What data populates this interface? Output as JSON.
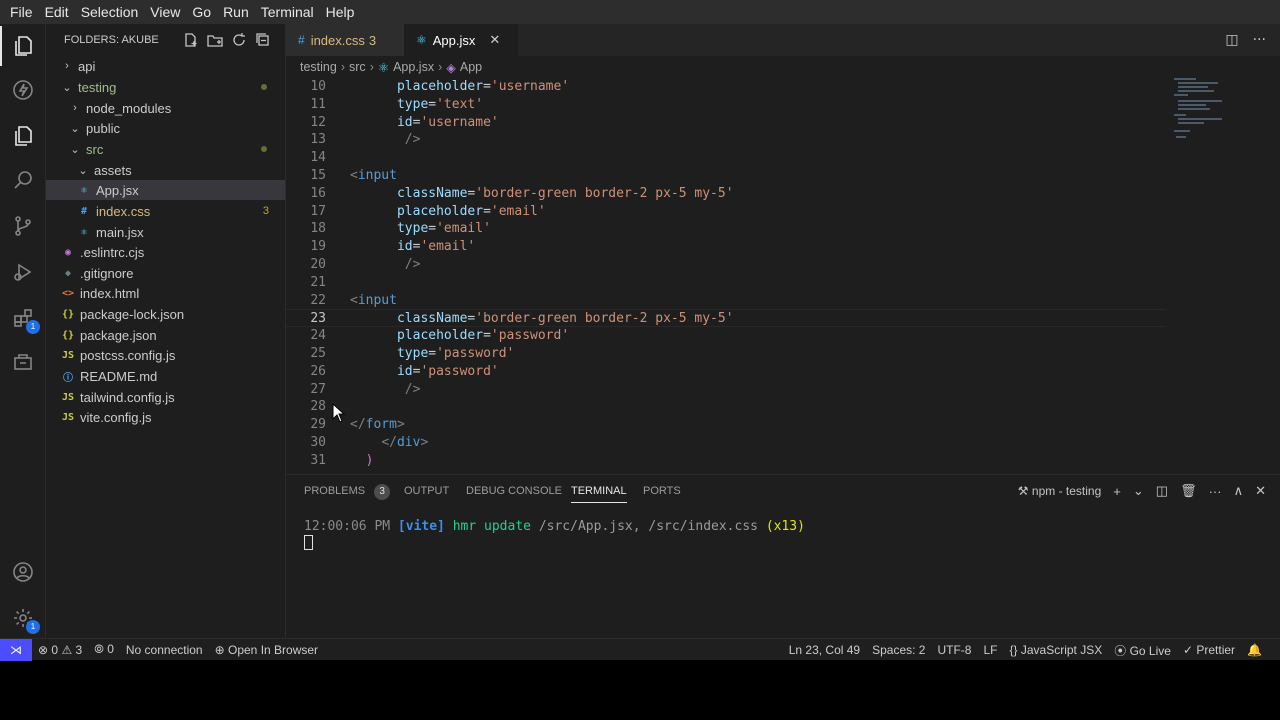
{
  "menu": [
    "File",
    "Edit",
    "Selection",
    "View",
    "Go",
    "Run",
    "Terminal",
    "Help"
  ],
  "activity": {
    "extensions_badge": "1",
    "settings_badge": "1"
  },
  "explorer": {
    "title": "FOLDERS: AKUBE",
    "items": [
      {
        "label": "api",
        "chevron": "›",
        "icon": "",
        "icon_color": "#cccccc"
      },
      {
        "label": "testing",
        "chevron": "⌄",
        "icon": "",
        "icon_color": "#cccccc"
      },
      {
        "label": "node_modules",
        "chevron": "›",
        "icon": "",
        "icon_color": "#cccccc"
      },
      {
        "label": "public",
        "chevron": "⌄",
        "icon": "",
        "icon_color": "#cccccc"
      },
      {
        "label": "src",
        "chevron": "⌄",
        "icon": "",
        "icon_color": "#cccccc"
      },
      {
        "label": "assets",
        "chevron": "⌄",
        "icon": "",
        "icon_color": "#cccccc"
      },
      {
        "label": "App.jsx",
        "chevron": "",
        "icon": "⚛",
        "icon_color": "#61dafb"
      },
      {
        "label": "index.css",
        "chevron": "",
        "icon": "#",
        "icon_color": "#42a5f5",
        "count": "3"
      },
      {
        "label": "main.jsx",
        "chevron": "",
        "icon": "⚛",
        "icon_color": "#61dafb"
      },
      {
        "label": ".eslintrc.cjs",
        "chevron": "",
        "icon": "◉",
        "icon_color": "#c678dd"
      },
      {
        "label": ".gitignore",
        "chevron": "",
        "icon": "◆",
        "icon_color": "#6d8086"
      },
      {
        "label": "index.html",
        "chevron": "",
        "icon": "<>",
        "icon_color": "#e37933"
      },
      {
        "label": "package-lock.json",
        "chevron": "",
        "icon": "{}",
        "icon_color": "#cbcb41"
      },
      {
        "label": "package.json",
        "chevron": "",
        "icon": "{}",
        "icon_color": "#cbcb41"
      },
      {
        "label": "postcss.config.js",
        "chevron": "",
        "icon": "JS",
        "icon_color": "#cbcb41"
      },
      {
        "label": "README.md",
        "chevron": "",
        "icon": "ⓘ",
        "icon_color": "#42a5f5"
      },
      {
        "label": "tailwind.config.js",
        "chevron": "",
        "icon": "JS",
        "icon_color": "#cbcb41"
      },
      {
        "label": "vite.config.js",
        "chevron": "",
        "icon": "JS",
        "icon_color": "#cbcb41"
      }
    ]
  },
  "tabs": [
    {
      "label": "index.css",
      "badge": "3",
      "icon": "#"
    },
    {
      "label": "App.jsx",
      "icon": "⚛",
      "close": "✕"
    }
  ],
  "breadcrumb": [
    "testing",
    "src",
    "App.jsx",
    "App"
  ],
  "code_lines": [
    {
      "n": "10",
      "tokens": [
        {
          "t": "      ",
          "c": ""
        },
        {
          "t": "placeholder",
          "c": "attr"
        },
        {
          "t": "=",
          "c": ""
        },
        {
          "t": "'username'",
          "c": "str"
        }
      ]
    },
    {
      "n": "11",
      "tokens": [
        {
          "t": "      ",
          "c": ""
        },
        {
          "t": "type",
          "c": "attr"
        },
        {
          "t": "=",
          "c": ""
        },
        {
          "t": "'text'",
          "c": "str"
        }
      ]
    },
    {
      "n": "12",
      "tokens": [
        {
          "t": "      ",
          "c": ""
        },
        {
          "t": "id",
          "c": "attr"
        },
        {
          "t": "=",
          "c": ""
        },
        {
          "t": "'username'",
          "c": "str"
        }
      ]
    },
    {
      "n": "13",
      "tokens": [
        {
          "t": "       ",
          "c": ""
        },
        {
          "t": "/>",
          "c": "punct"
        }
      ]
    },
    {
      "n": "14",
      "tokens": []
    },
    {
      "n": "15",
      "tokens": [
        {
          "t": "<",
          "c": "punct"
        },
        {
          "t": "input",
          "c": "tag"
        }
      ]
    },
    {
      "n": "16",
      "tokens": [
        {
          "t": "      ",
          "c": ""
        },
        {
          "t": "className",
          "c": "attr"
        },
        {
          "t": "=",
          "c": ""
        },
        {
          "t": "'border-green border-2 px-5 my-5'",
          "c": "str"
        }
      ]
    },
    {
      "n": "17",
      "tokens": [
        {
          "t": "      ",
          "c": ""
        },
        {
          "t": "placeholder",
          "c": "attr"
        },
        {
          "t": "=",
          "c": ""
        },
        {
          "t": "'email'",
          "c": "str"
        }
      ]
    },
    {
      "n": "18",
      "tokens": [
        {
          "t": "      ",
          "c": ""
        },
        {
          "t": "type",
          "c": "attr"
        },
        {
          "t": "=",
          "c": ""
        },
        {
          "t": "'email'",
          "c": "str"
        }
      ]
    },
    {
      "n": "19",
      "tokens": [
        {
          "t": "      ",
          "c": ""
        },
        {
          "t": "id",
          "c": "attr"
        },
        {
          "t": "=",
          "c": ""
        },
        {
          "t": "'email'",
          "c": "str"
        }
      ]
    },
    {
      "n": "20",
      "tokens": [
        {
          "t": "       ",
          "c": ""
        },
        {
          "t": "/>",
          "c": "punct"
        }
      ]
    },
    {
      "n": "21",
      "tokens": []
    },
    {
      "n": "22",
      "tokens": [
        {
          "t": "<",
          "c": "punct"
        },
        {
          "t": "input",
          "c": "tag"
        }
      ]
    },
    {
      "n": "23",
      "tokens": [
        {
          "t": "      ",
          "c": ""
        },
        {
          "t": "className",
          "c": "attr"
        },
        {
          "t": "=",
          "c": ""
        },
        {
          "t": "'border-green border-2 px-5 my-5'",
          "c": "str"
        }
      ],
      "current": true
    },
    {
      "n": "24",
      "tokens": [
        {
          "t": "      ",
          "c": ""
        },
        {
          "t": "placeholder",
          "c": "attr"
        },
        {
          "t": "=",
          "c": ""
        },
        {
          "t": "'password'",
          "c": "str"
        }
      ]
    },
    {
      "n": "25",
      "tokens": [
        {
          "t": "      ",
          "c": ""
        },
        {
          "t": "type",
          "c": "attr"
        },
        {
          "t": "=",
          "c": ""
        },
        {
          "t": "'password'",
          "c": "str"
        }
      ]
    },
    {
      "n": "26",
      "tokens": [
        {
          "t": "      ",
          "c": ""
        },
        {
          "t": "id",
          "c": "attr"
        },
        {
          "t": "=",
          "c": ""
        },
        {
          "t": "'password'",
          "c": "str"
        }
      ]
    },
    {
      "n": "27",
      "tokens": [
        {
          "t": "       ",
          "c": ""
        },
        {
          "t": "/>",
          "c": "punct"
        }
      ]
    },
    {
      "n": "28",
      "tokens": []
    },
    {
      "n": "29",
      "tokens": [
        {
          "t": "</",
          "c": "punct"
        },
        {
          "t": "form",
          "c": "tag"
        },
        {
          "t": ">",
          "c": "punct"
        }
      ]
    },
    {
      "n": "30",
      "tokens": [
        {
          "t": "    ",
          "c": ""
        },
        {
          "t": "</",
          "c": "punct"
        },
        {
          "t": "div",
          "c": "tag"
        },
        {
          "t": ">",
          "c": "punct"
        }
      ]
    },
    {
      "n": "31",
      "tokens": [
        {
          "t": "  ",
          "c": ""
        },
        {
          "t": ")",
          "c": "paren"
        }
      ]
    }
  ],
  "panel": {
    "tabs": [
      "PROBLEMS",
      "OUTPUT",
      "DEBUG CONSOLE",
      "TERMINAL",
      "PORTS"
    ],
    "problems_count": "3",
    "terminal_name": "npm - testing",
    "terminal": {
      "time": "12:00:06 PM",
      "tag": "[vite]",
      "action": "hmr update",
      "paths": "/src/App.jsx, /src/index.css",
      "count": "(x13)"
    }
  },
  "status": {
    "errors": "0",
    "warnings": "3",
    "ports": "0",
    "connection": "No connection",
    "open_in_browser": "Open In Browser",
    "position": "Ln 23, Col 49",
    "spaces": "Spaces: 2",
    "encoding": "UTF-8",
    "eol": "LF",
    "language": "JavaScript JSX",
    "go_live": "Go Live",
    "prettier": "Prettier"
  },
  "colors": {
    "accent": "#4d4dff",
    "badge": "#1f6feb",
    "warning": "#cca700"
  }
}
